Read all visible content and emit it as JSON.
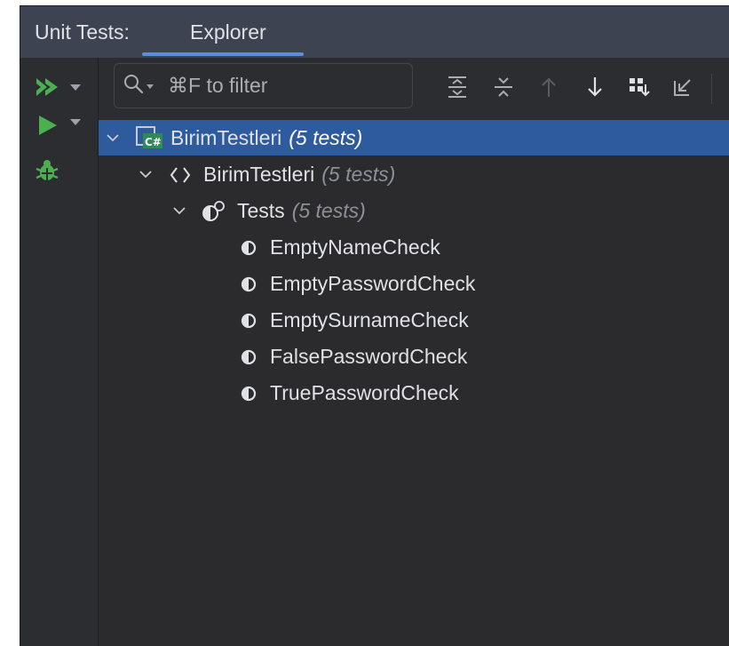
{
  "header": {
    "title": "Unit Tests:",
    "tab_label": "Explorer"
  },
  "left_toolbar": {
    "icons": [
      "run-all-icon",
      "run-icon",
      "debug-icon"
    ]
  },
  "toolbar": {
    "search_placeholder": "⌘F to filter",
    "icons": [
      "expand-all-icon",
      "collapse-all-icon",
      "arrow-up-icon",
      "arrow-down-icon",
      "group-by-icon",
      "import-icon"
    ]
  },
  "tree": {
    "project": {
      "name": "BirimTestleri",
      "count": "(5 tests)",
      "icon": "csharp-project-icon"
    },
    "namespace": {
      "name": "BirimTestleri",
      "count": "(5 tests)",
      "icon": "namespace-icon"
    },
    "class": {
      "name": "Tests",
      "count": "(5 tests)",
      "icon": "test-class-icon"
    },
    "tests": [
      "EmptyNameCheck",
      "EmptyPasswordCheck",
      "EmptySurnameCheck",
      "FalsePasswordCheck",
      "TruePasswordCheck"
    ]
  },
  "colors": {
    "accent": "#5e8fd6",
    "selection": "#2e5b9d",
    "run_green": "#4caf50"
  }
}
